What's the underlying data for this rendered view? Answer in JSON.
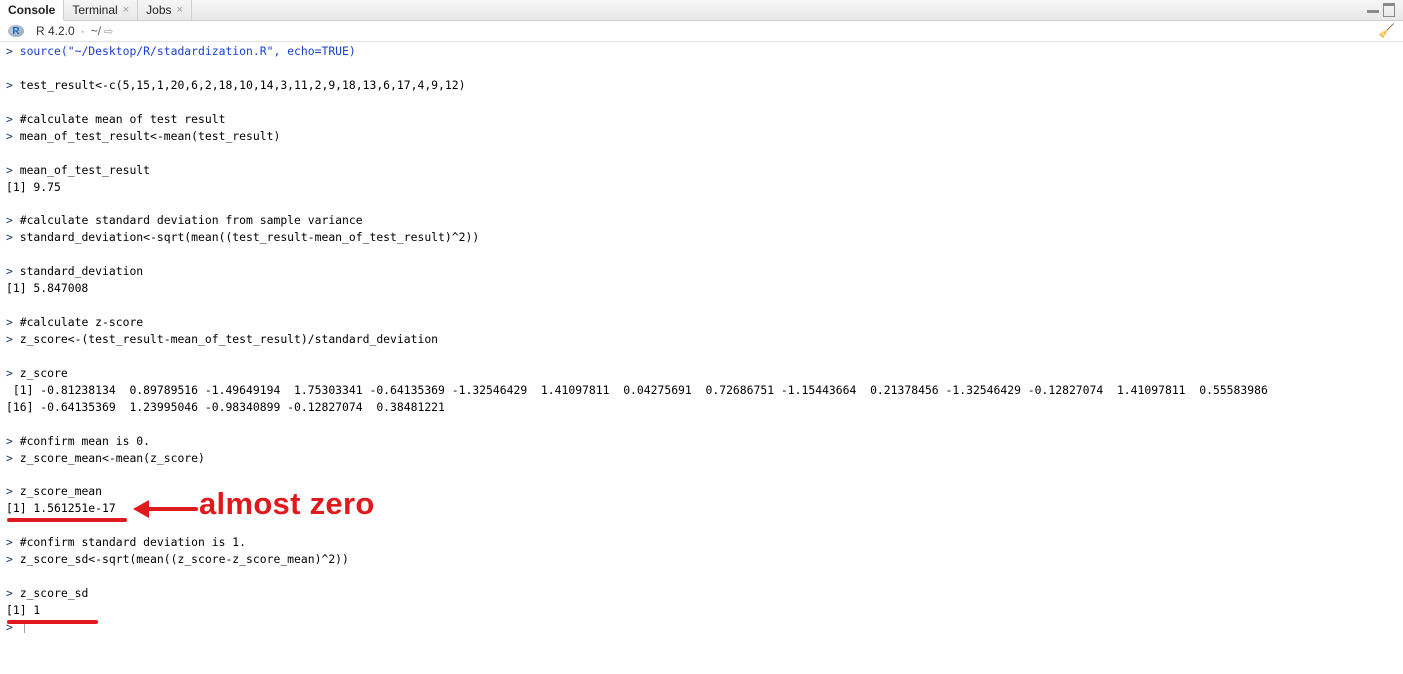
{
  "tabs": [
    {
      "label": "Console",
      "active": true,
      "closable": false
    },
    {
      "label": "Terminal",
      "active": false,
      "closable": true
    },
    {
      "label": "Jobs",
      "active": false,
      "closable": true
    }
  ],
  "toolbar": {
    "r_version": "R 4.2.0",
    "separator": "·",
    "working_dir": "~/"
  },
  "console": {
    "lines": [
      {
        "kind": "cmd-blue",
        "text": "source(\"~/Desktop/R/stadardization.R\", echo=TRUE)"
      },
      {
        "kind": "blank",
        "text": ""
      },
      {
        "kind": "cmd",
        "text": "test_result<-c(5,15,1,20,6,2,18,10,14,3,11,2,9,18,13,6,17,4,9,12)"
      },
      {
        "kind": "blank",
        "text": ""
      },
      {
        "kind": "cmd",
        "text": "#calculate mean of test result"
      },
      {
        "kind": "cmd",
        "text": "mean_of_test_result<-mean(test_result)"
      },
      {
        "kind": "blank",
        "text": ""
      },
      {
        "kind": "cmd",
        "text": "mean_of_test_result"
      },
      {
        "kind": "out",
        "text": "[1] 9.75"
      },
      {
        "kind": "blank",
        "text": ""
      },
      {
        "kind": "cmd",
        "text": "#calculate standard deviation from sample variance"
      },
      {
        "kind": "cmd",
        "text": "standard_deviation<-sqrt(mean((test_result-mean_of_test_result)^2))"
      },
      {
        "kind": "blank",
        "text": ""
      },
      {
        "kind": "cmd",
        "text": "standard_deviation"
      },
      {
        "kind": "out",
        "text": "[1] 5.847008"
      },
      {
        "kind": "blank",
        "text": ""
      },
      {
        "kind": "cmd",
        "text": "#calculate z-score"
      },
      {
        "kind": "cmd",
        "text": "z_score<-(test_result-mean_of_test_result)/standard_deviation"
      },
      {
        "kind": "blank",
        "text": ""
      },
      {
        "kind": "cmd",
        "text": "z_score"
      },
      {
        "kind": "out",
        "text": " [1] -0.81238134  0.89789516 -1.49649194  1.75303341 -0.64135369 -1.32546429  1.41097811  0.04275691  0.72686751 -1.15443664  0.21378456 -1.32546429 -0.12827074  1.41097811  0.55583986"
      },
      {
        "kind": "out",
        "text": "[16] -0.64135369  1.23995046 -0.98340899 -0.12827074  0.38481221"
      },
      {
        "kind": "blank",
        "text": ""
      },
      {
        "kind": "cmd",
        "text": "#confirm mean is 0."
      },
      {
        "kind": "cmd",
        "text": "z_score_mean<-mean(z_score)"
      },
      {
        "kind": "blank",
        "text": ""
      },
      {
        "kind": "cmd",
        "text": "z_score_mean"
      },
      {
        "kind": "out",
        "text": "[1] 1.561251e-17"
      },
      {
        "kind": "blank",
        "text": ""
      },
      {
        "kind": "cmd",
        "text": "#confirm standard deviation is 1."
      },
      {
        "kind": "cmd",
        "text": "z_score_sd<-sqrt(mean((z_score-z_score_mean)^2))"
      },
      {
        "kind": "blank",
        "text": ""
      },
      {
        "kind": "cmd",
        "text": "z_score_sd"
      },
      {
        "kind": "out",
        "text": "[1] 1"
      },
      {
        "kind": "prompt",
        "text": ""
      }
    ]
  },
  "annotation": {
    "text": "almost zero",
    "color": "#e0191d"
  },
  "colors": {
    "prompt": "#1c3c6e",
    "source_command": "#1a3fd1",
    "annotation": "#e0191d"
  }
}
